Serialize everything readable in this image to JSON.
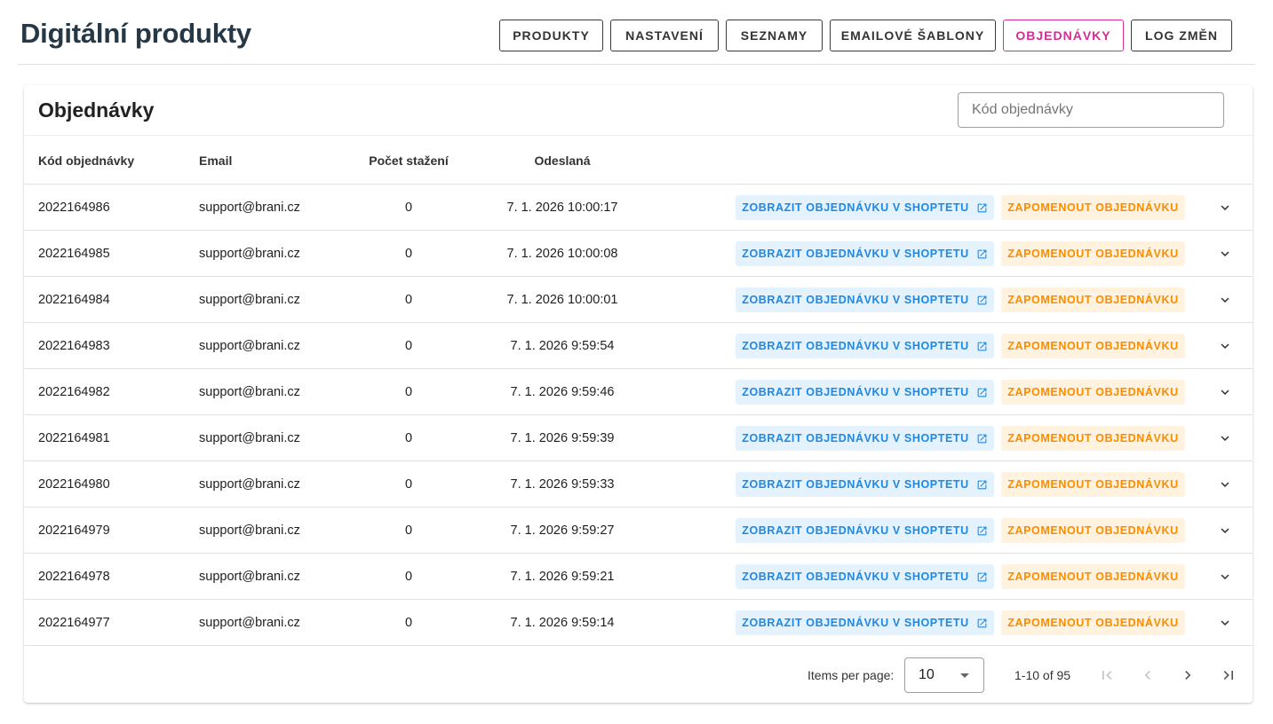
{
  "header": {
    "title": "Digitální produkty",
    "nav": [
      {
        "label": "Produkty",
        "active": false
      },
      {
        "label": "Nastavení",
        "active": false
      },
      {
        "label": "Seznamy",
        "active": false
      },
      {
        "label": "Emailové šablony",
        "active": false
      },
      {
        "label": "Objednávky",
        "active": true
      },
      {
        "label": "Log změn",
        "active": false
      }
    ]
  },
  "orders": {
    "title": "Objednávky",
    "search_placeholder": "Kód objednávky",
    "columns": {
      "code": "Kód objednávky",
      "email": "Email",
      "downloads": "Počet stažení",
      "sent": "Odeslaná"
    },
    "view_label": "Zobrazit objednávku v Shoptetu",
    "forget_label": "Zapomenout objednávku",
    "rows": [
      {
        "code": "2022164986",
        "email": "support@brani.cz",
        "downloads": "0",
        "sent": "7. 1. 2026 10:00:17"
      },
      {
        "code": "2022164985",
        "email": "support@brani.cz",
        "downloads": "0",
        "sent": "7. 1. 2026 10:00:08"
      },
      {
        "code": "2022164984",
        "email": "support@brani.cz",
        "downloads": "0",
        "sent": "7. 1. 2026 10:00:01"
      },
      {
        "code": "2022164983",
        "email": "support@brani.cz",
        "downloads": "0",
        "sent": "7. 1. 2026 9:59:54"
      },
      {
        "code": "2022164982",
        "email": "support@brani.cz",
        "downloads": "0",
        "sent": "7. 1. 2026 9:59:46"
      },
      {
        "code": "2022164981",
        "email": "support@brani.cz",
        "downloads": "0",
        "sent": "7. 1. 2026 9:59:39"
      },
      {
        "code": "2022164980",
        "email": "support@brani.cz",
        "downloads": "0",
        "sent": "7. 1. 2026 9:59:33"
      },
      {
        "code": "2022164979",
        "email": "support@brani.cz",
        "downloads": "0",
        "sent": "7. 1. 2026 9:59:27"
      },
      {
        "code": "2022164978",
        "email": "support@brani.cz",
        "downloads": "0",
        "sent": "7. 1. 2026 9:59:21"
      },
      {
        "code": "2022164977",
        "email": "support@brani.cz",
        "downloads": "0",
        "sent": "7. 1. 2026 9:59:14"
      }
    ]
  },
  "paginator": {
    "items_per_page_label": "Items per page:",
    "items_per_page": "10",
    "range": "1-10 of 95"
  },
  "colors": {
    "title": "#263746",
    "active_nav": "#d12f96",
    "view_bg": "#e3f2fd",
    "view_text": "#1e88e5",
    "forget_bg": "#fff3e0",
    "forget_text": "#fb8c00"
  }
}
